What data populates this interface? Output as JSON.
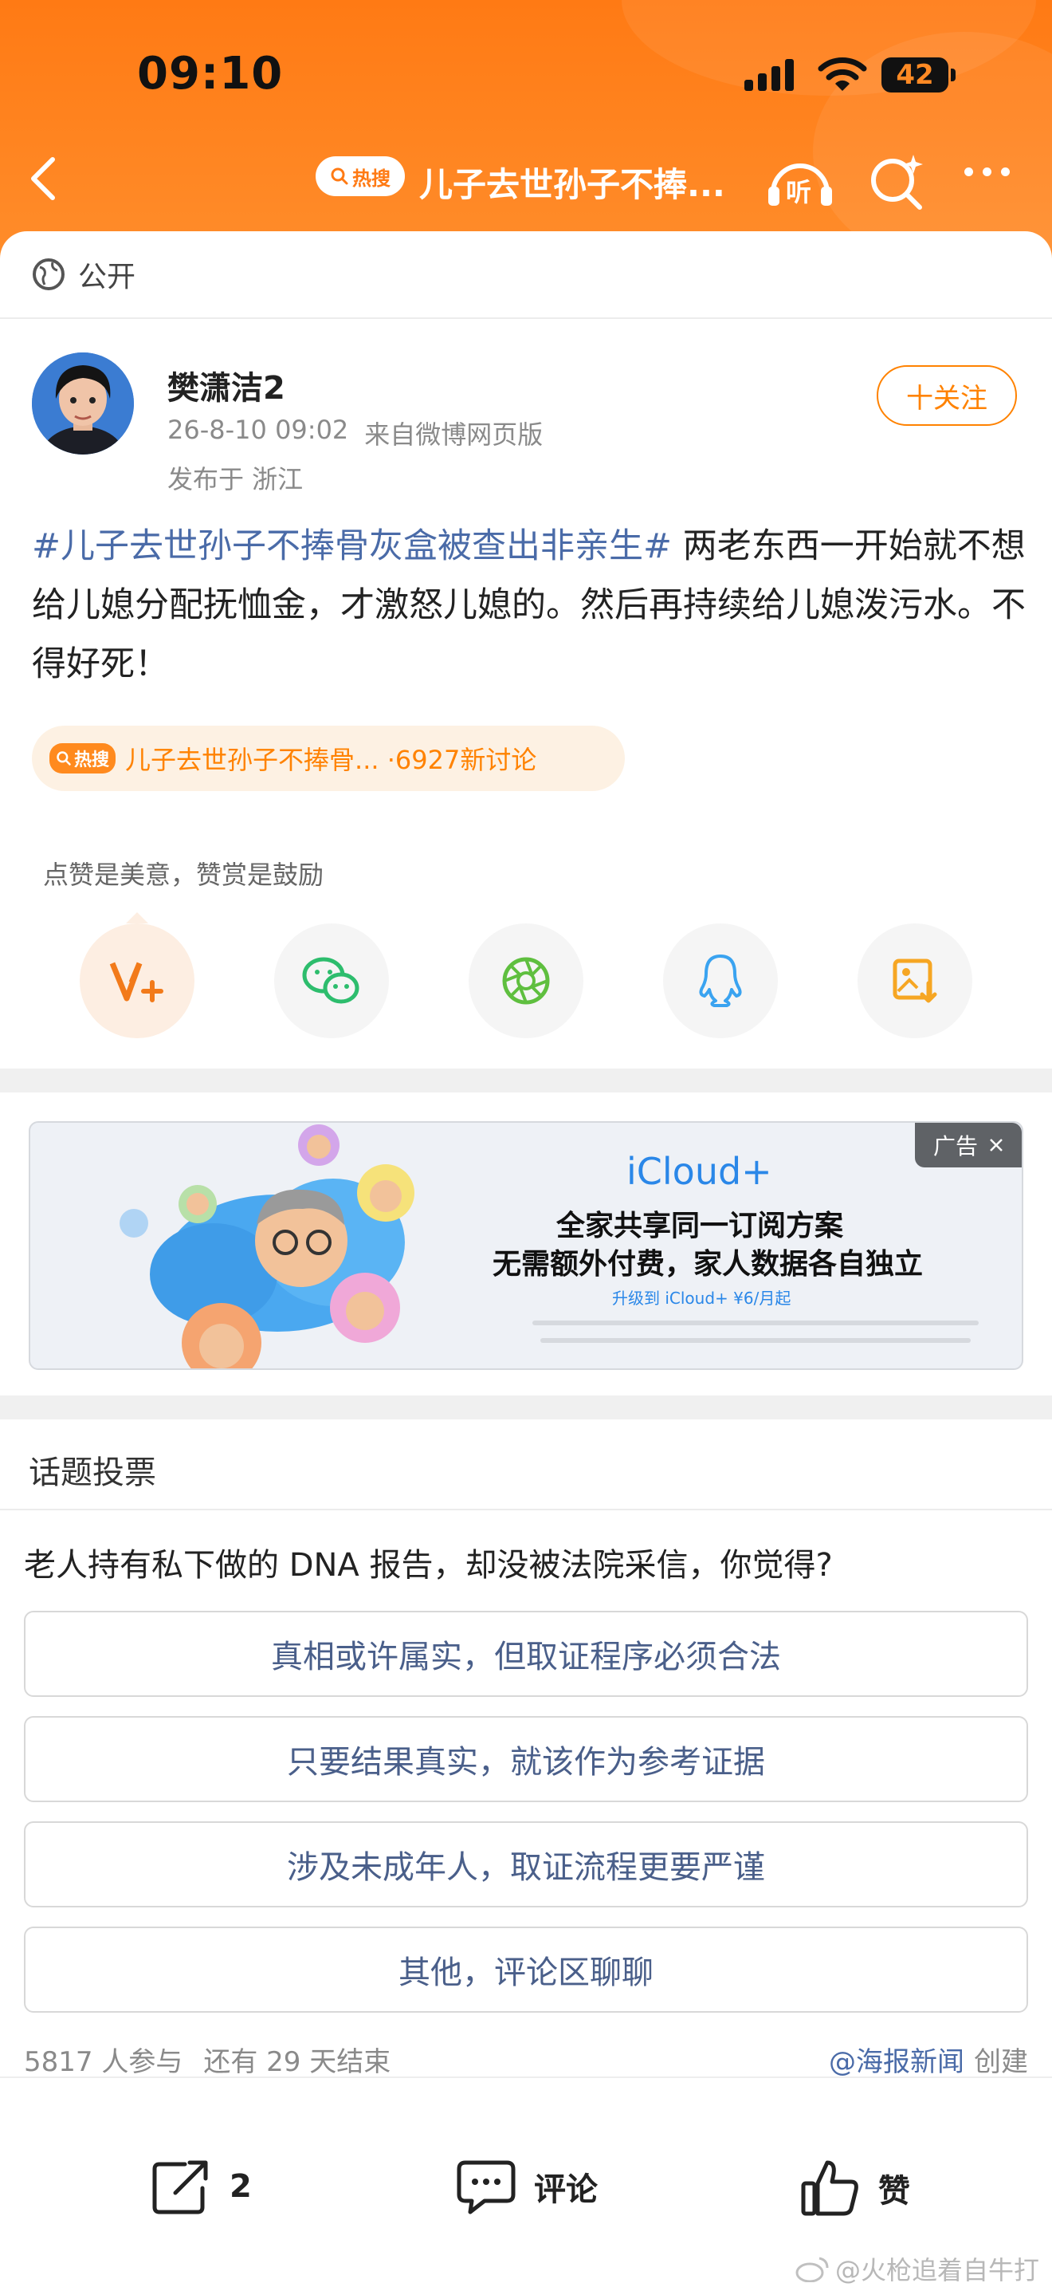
{
  "status_bar": {
    "time": "09:10",
    "battery": "42"
  },
  "nav": {
    "hot_badge": "热搜",
    "title": "儿子去世孙子不捧...",
    "listen_label": "听"
  },
  "visibility": {
    "label": "公开"
  },
  "author": {
    "name": "樊潇洁2",
    "datetime": "26-8-10 09:02",
    "source": "来自微博网页版",
    "location": "发布于 浙江",
    "follow_label": "十关注"
  },
  "post": {
    "hashtag": "#儿子去世孙子不捧骨灰盒被查出非亲生#",
    "body": " 两老东西一开始就不想给儿媳分配抚恤金，才激怒儿媳的。然后再持续给儿媳泼污水。不得好死！"
  },
  "topic_pill": {
    "badge": "热搜",
    "text": "儿子去世孙子不捧骨... ·6927新讨论"
  },
  "tip": {
    "text": "点赞是美意，赞赏是鼓励"
  },
  "share_icons": [
    "v-plus-icon",
    "wechat-icon",
    "moments-icon",
    "qq-icon",
    "save-image-icon"
  ],
  "ad": {
    "tag": "广告",
    "brand": "iCloud+",
    "line1": "全家共享同一订阅方案",
    "line2": "无需额外付费，家人数据各自独立",
    "cta": "升级到 iCloud+ ¥6/月起"
  },
  "vote": {
    "heading": "话题投票",
    "question": "老人持有私下做的 DNA 报告，却没被法院采信，你觉得?",
    "options": [
      "真相或许属实，但取证程序必须合法",
      "只要结果真实，就该作为参考证据",
      "涉及未成年人，取证流程更要严谨",
      "其他，评论区聊聊"
    ],
    "participants": "5817 人参与",
    "remaining": "还有 29 天结束",
    "creator": "@海报新闻",
    "created_label": "创建"
  },
  "actions": {
    "share_count": "2",
    "comment_label": "评论",
    "like_label": "赞"
  },
  "watermark": "@火枪追着自牛打",
  "colors": {
    "brand_orange": "#ff8200",
    "link_blue": "#4a6ba8"
  }
}
